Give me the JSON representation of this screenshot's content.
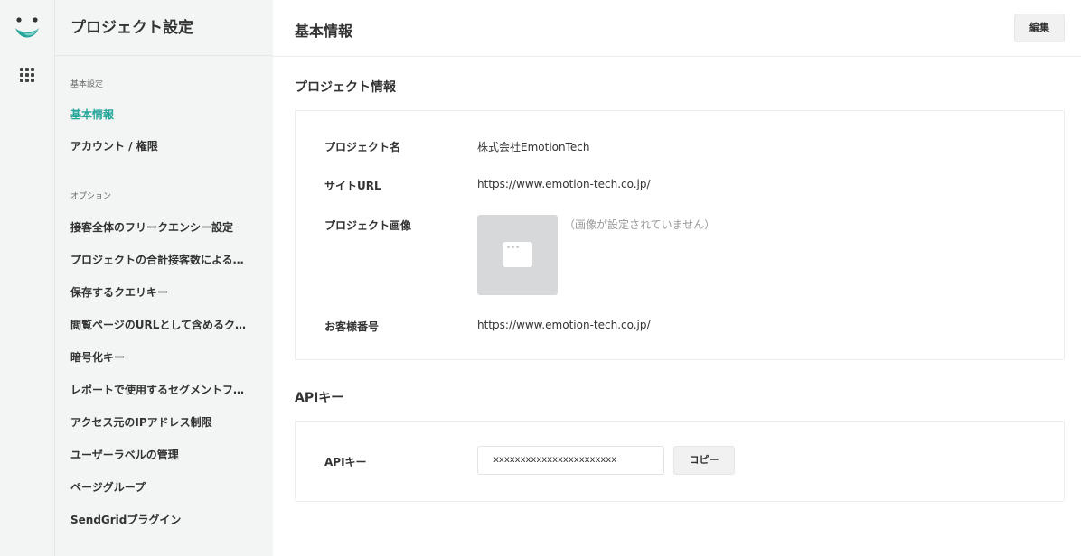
{
  "colors": {
    "accent": "#26a69a",
    "rail_bg": "#f3f4f4",
    "placeholder_bg": "#d6d8d9"
  },
  "rail": {
    "logo_icon": "smile-logo-icon",
    "apps_icon": "grid-apps-icon"
  },
  "sidebar": {
    "title": "プロジェクト設定",
    "section_basic": "基本設定",
    "basic_items": [
      {
        "label": "基本情報",
        "active": true
      },
      {
        "label": "アカウント / 権限",
        "active": false
      }
    ],
    "section_options": "オプション",
    "option_items": [
      {
        "label": "接客全体のフリークエンシー設定"
      },
      {
        "label": "プロジェクトの合計接客数による…"
      },
      {
        "label": "保存するクエリキー"
      },
      {
        "label": "閲覧ページのURLとして含めるク…"
      },
      {
        "label": "暗号化キー"
      },
      {
        "label": "レポートで使用するセグメントフ…"
      },
      {
        "label": "アクセス元のIPアドレス制限"
      },
      {
        "label": "ユーザーラベルの管理"
      },
      {
        "label": "ページグループ"
      },
      {
        "label": "SendGridプラグイン"
      }
    ]
  },
  "main": {
    "title": "基本情報",
    "edit_label": "編集",
    "project_section_title": "プロジェクト情報",
    "project": {
      "name_label": "プロジェクト名",
      "name_value": "株式会社EmotionTech",
      "site_label": "サイトURL",
      "site_value": "https://www.emotion-tech.co.jp/",
      "image_label": "プロジェクト画像",
      "image_empty": "（画像が設定されていません）",
      "customer_label": "お客様番号",
      "customer_value": "https://www.emotion-tech.co.jp/"
    },
    "api_section_title": "APIキー",
    "api": {
      "label": "APIキー",
      "value": "xxxxxxxxxxxxxxxxxxxxxxx",
      "copy_label": "コピー"
    }
  }
}
